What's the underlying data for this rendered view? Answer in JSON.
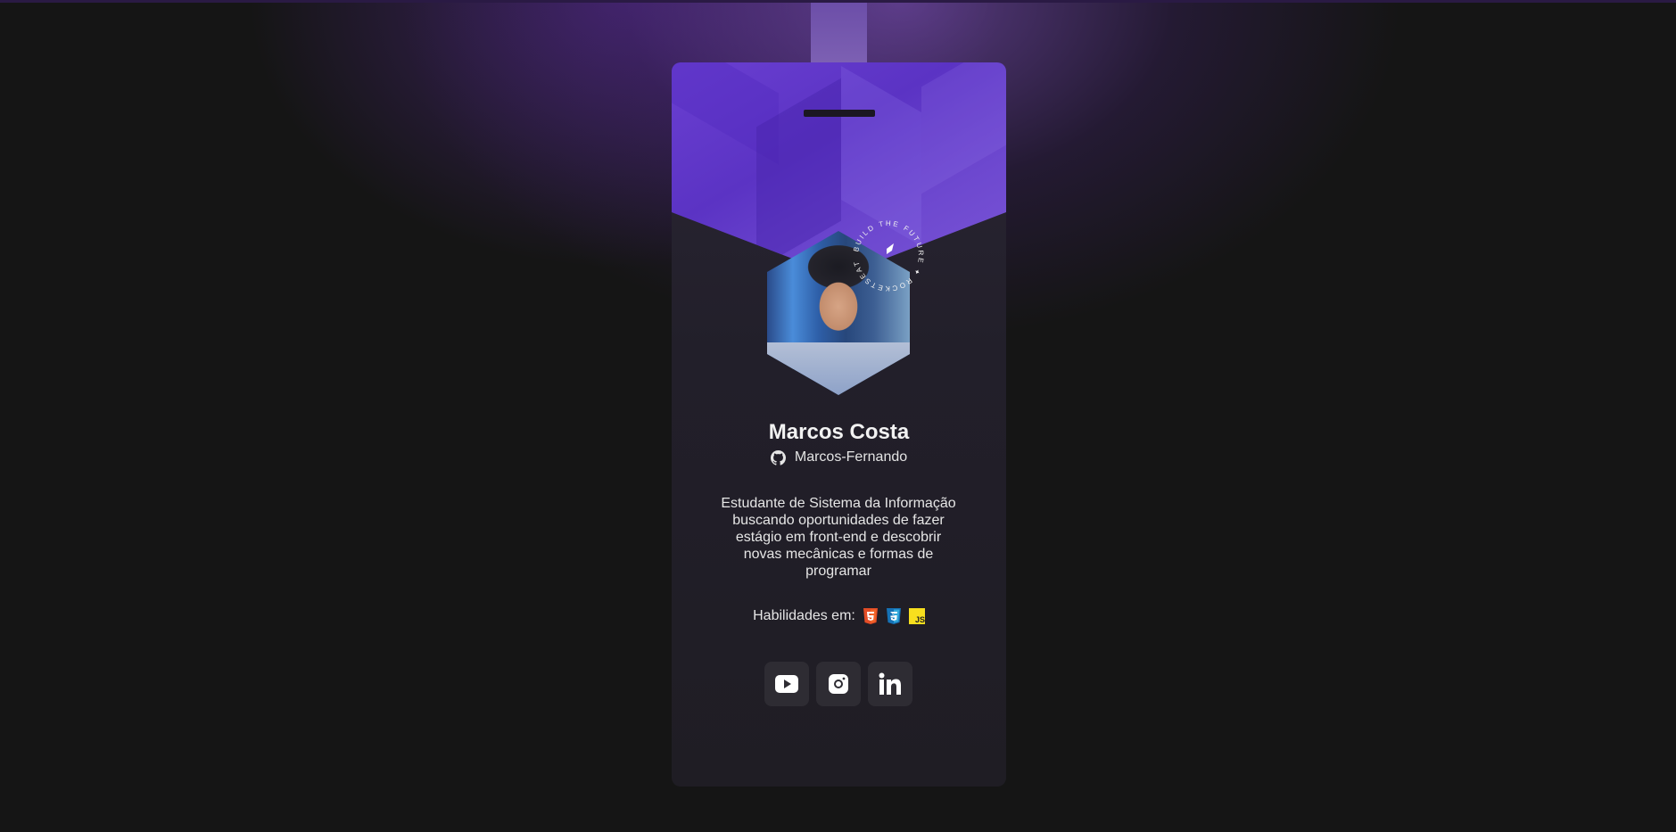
{
  "profile": {
    "name": "Marcos Costa",
    "github_user": "Marcos-Fernando",
    "bio": "Estudante de Sistema da Informação buscando oportunidades de fazer estágio em front-end e descobrir novas mecânicas e formas de programar",
    "skills_label": "Habilidades em:",
    "skills": [
      "html5-icon",
      "css3-icon",
      "javascript-icon"
    ],
    "badge_ring_text": "BUILD THE FUTURE ✦ ROCKETSEAT"
  },
  "socials": [
    {
      "icon": "youtube-icon"
    },
    {
      "icon": "instagram-icon"
    },
    {
      "icon": "linkedin-icon"
    }
  ],
  "colors": {
    "background": "#151515",
    "card": "#222027",
    "accent": "#5b33c4",
    "social_button": "#2e2c33"
  }
}
